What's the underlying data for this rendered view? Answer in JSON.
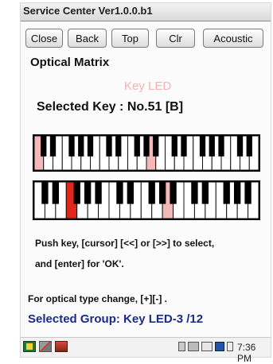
{
  "window": {
    "title": "Service Center Ver1.0.0.b1"
  },
  "toolbar": {
    "buttons": [
      {
        "label": "Close"
      },
      {
        "label": "Back"
      },
      {
        "label": "Top"
      },
      {
        "label": "Clr"
      },
      {
        "label": "Acoustic"
      }
    ]
  },
  "main": {
    "heading": "Optical Matrix",
    "mode": "Key LED",
    "selected_key": "Selected Key : No.51 [B]",
    "instruction_line1": "Push key, [cursor] [<<] or [>>] to select,",
    "instruction_line2": "and [enter] for 'OK'.",
    "optical_hint": "For optical type change, [+][-] .",
    "selected_group": "Selected Group: Key LED-3 /12"
  },
  "keyboard": {
    "highlight_color": "#f3b9b9",
    "active_color": "#e0281a",
    "top_row": {
      "white_keys": 24,
      "highlighted_white_keys": [
        0,
        12
      ]
    },
    "bottom_row": {
      "white_keys": 21,
      "highlighted_white_keys": [
        12
      ],
      "active_white_keys": [
        3
      ]
    }
  },
  "taskbar": {
    "icons": [
      "start-icon",
      "brush-icon",
      "toolbox-icon",
      "lock-icon",
      "volume-icon",
      "keyboard-icon",
      "input-method-icon",
      "battery-icon"
    ],
    "clock": "7:36 PM"
  }
}
